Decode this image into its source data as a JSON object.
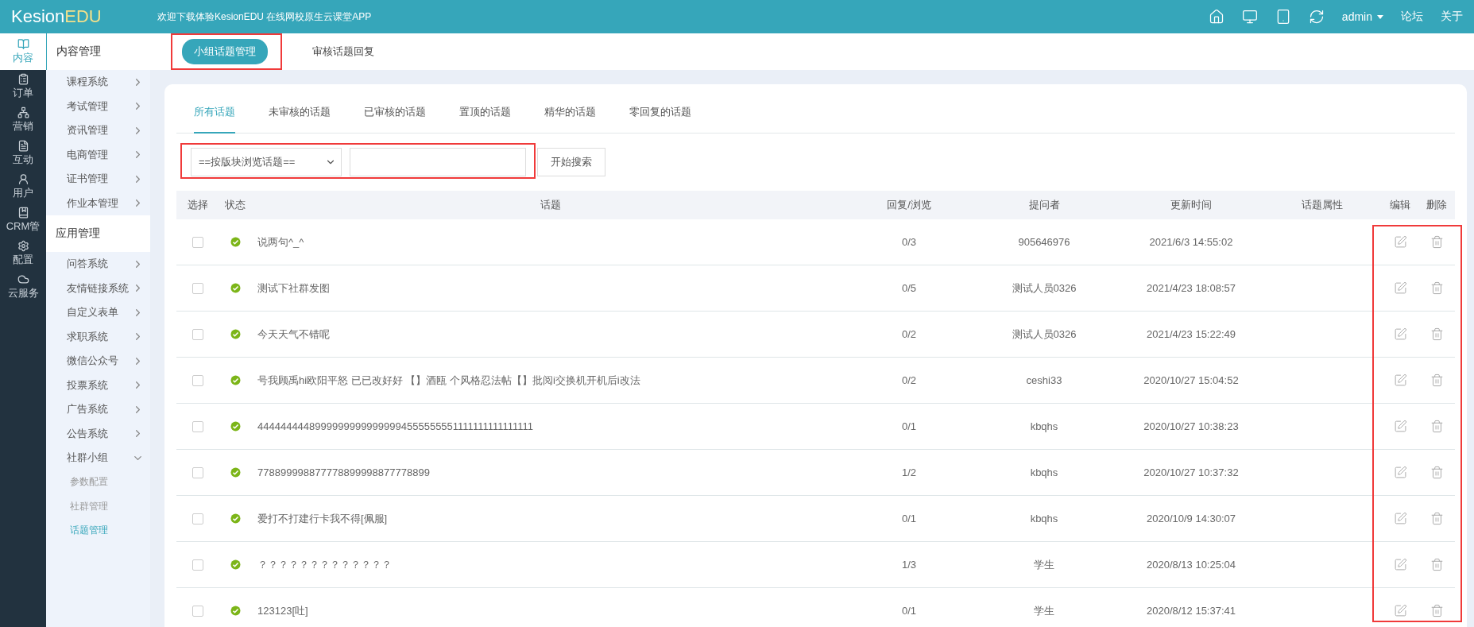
{
  "top_bar": {
    "logo": [
      "Kesion",
      "EDU"
    ],
    "announcement": "欢迎下载体验KesionEDU 在线网校原生云课堂APP",
    "user": "admin",
    "links": [
      "论坛",
      "关于"
    ]
  },
  "rail": [
    {
      "label": "内容",
      "selected": true
    },
    {
      "label": "订单",
      "selected": false
    },
    {
      "label": "营销",
      "selected": false
    },
    {
      "label": "互动",
      "selected": false
    },
    {
      "label": "用户",
      "selected": false
    },
    {
      "label": "CRM管",
      "selected": false
    },
    {
      "label": "配置",
      "selected": false
    },
    {
      "label": "云服务",
      "selected": false
    }
  ],
  "submenu": [
    {
      "title": "内容管理",
      "items": [
        {
          "label": "课程系统",
          "expanded": false
        },
        {
          "label": "考试管理",
          "expanded": false
        },
        {
          "label": "资讯管理",
          "expanded": false
        },
        {
          "label": "电商管理",
          "expanded": false
        },
        {
          "label": "证书管理",
          "expanded": false
        },
        {
          "label": "作业本管理",
          "expanded": false
        }
      ]
    },
    {
      "title": "应用管理",
      "items": [
        {
          "label": "问答系统",
          "expanded": false
        },
        {
          "label": "友情链接系统",
          "expanded": false
        },
        {
          "label": "自定义表单",
          "expanded": false
        },
        {
          "label": "求职系统",
          "expanded": false
        },
        {
          "label": "微信公众号",
          "expanded": false
        },
        {
          "label": "投票系统",
          "expanded": false
        },
        {
          "label": "广告系统",
          "expanded": false
        },
        {
          "label": "公告系统",
          "expanded": false
        },
        {
          "label": "社群小组",
          "expanded": true,
          "children": [
            {
              "label": "参数配置",
              "selected": false
            },
            {
              "label": "社群管理",
              "selected": false
            },
            {
              "label": "话题管理",
              "selected": true
            }
          ]
        }
      ]
    }
  ],
  "page_tabs": [
    {
      "label": "小组话题管理",
      "selected": true
    },
    {
      "label": "审核话题回复",
      "selected": false
    }
  ],
  "filter_tabs": [
    {
      "label": "所有话题",
      "selected": true
    },
    {
      "label": "未审核的话题",
      "selected": false
    },
    {
      "label": "已审核的话题",
      "selected": false
    },
    {
      "label": "置顶的话题",
      "selected": false
    },
    {
      "label": "精华的话题",
      "selected": false
    },
    {
      "label": "零回复的话题",
      "selected": false
    }
  ],
  "search": {
    "board_select": "==按版块浏览话题==",
    "button": "开始搜索"
  },
  "table": {
    "columns": [
      "选择",
      "状态",
      "话题",
      "回复/浏览",
      "提问者",
      "更新时间",
      "话题属性",
      "编辑",
      "删除"
    ],
    "rows": [
      {
        "checked": false,
        "approved": true,
        "topic": "说两句^_^",
        "replies_views": "0/3",
        "author": "905646976",
        "updated": "2021/6/3 14:55:02"
      },
      {
        "checked": false,
        "approved": true,
        "topic": "测试下社群发图",
        "replies_views": "0/5",
        "author": "测试人员0326",
        "updated": "2021/4/23 18:08:57"
      },
      {
        "checked": false,
        "approved": true,
        "topic": "今天天气不错呢",
        "replies_views": "0/2",
        "author": "测试人员0326",
        "updated": "2021/4/23 15:22:49"
      },
      {
        "checked": false,
        "approved": true,
        "topic": "号我顾禹hi欧阳平怒 已已改好好 【】酒瓯 个风格忍法帖【】批阅i交换机开机后i改法",
        "replies_views": "0/2",
        "author": "ceshi33",
        "updated": "2020/10/27 15:04:52"
      },
      {
        "checked": false,
        "approved": true,
        "topic": "44444444489999999999999994555555551111111111111111",
        "replies_views": "0/1",
        "author": "kbqhs",
        "updated": "2020/10/27 10:38:23"
      },
      {
        "checked": false,
        "approved": true,
        "topic": "778899998877778899998877778899",
        "replies_views": "1/2",
        "author": "kbqhs",
        "updated": "2020/10/27 10:37:32"
      },
      {
        "checked": false,
        "approved": true,
        "topic": "爱打不打建行卡我不得[佩服]",
        "replies_views": "0/1",
        "author": "kbqhs",
        "updated": "2020/10/9 14:30:07"
      },
      {
        "checked": false,
        "approved": true,
        "topic": "？？？？？？？？？？？？？",
        "replies_views": "1/3",
        "author": "学生",
        "updated": "2020/8/13 10:25:04"
      },
      {
        "checked": false,
        "approved": true,
        "topic": "123123[吐]",
        "replies_views": "0/1",
        "author": "学生",
        "updated": "2020/8/12 15:37:41"
      }
    ]
  }
}
